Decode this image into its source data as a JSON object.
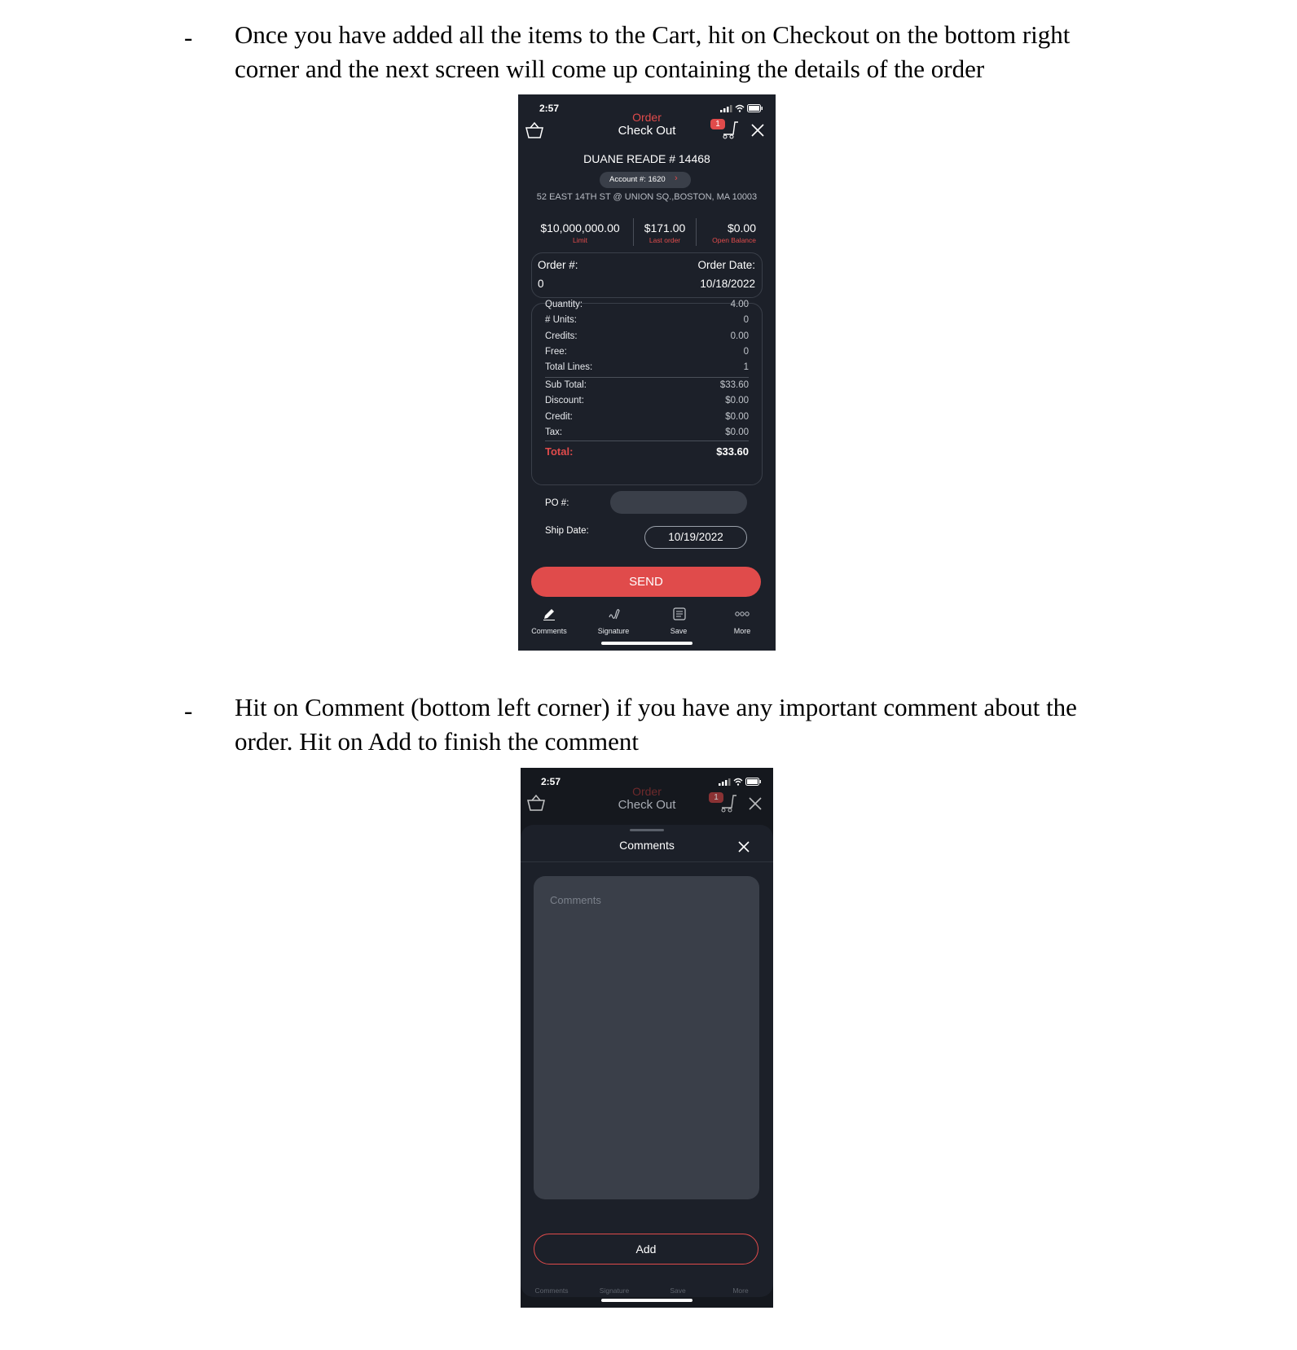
{
  "instructions": {
    "bullet": "-",
    "step1": "Once you have added all the items to the Cart, hit on Checkout on the bottom right corner and the next screen will come up containing the details of the order",
    "step2": "Hit on Comment (bottom left corner) if you have any important comment about the order. Hit on Add to finish the comment"
  },
  "screen1": {
    "time": "2:57",
    "title_top": "Order",
    "title_bottom": "Check Out",
    "cart_badge": "1",
    "store_name": "DUANE READE # 14468",
    "account": "Account #: 1620",
    "address": "52 EAST 14TH ST @ UNION SQ.,BOSTON, MA 10003",
    "stats": [
      {
        "value": "$10,000,000.00",
        "label": "Limit"
      },
      {
        "value": "$171.00",
        "label": "Last order"
      },
      {
        "value": "$0.00",
        "label": "Open Balance"
      }
    ],
    "order_no_label": "Order #:",
    "order_no_value": "0",
    "order_date_label": "Order Date:",
    "order_date_value": "10/18/2022",
    "summary_top": [
      {
        "label": "Quantity:",
        "value": "4.00"
      },
      {
        "label": "# Units:",
        "value": "0"
      },
      {
        "label": "Credits:",
        "value": "0.00"
      },
      {
        "label": "Free:",
        "value": "0"
      },
      {
        "label": "Total Lines:",
        "value": "1"
      }
    ],
    "summary_money": [
      {
        "label": "Sub Total:",
        "value": "$33.60"
      },
      {
        "label": "Discount:",
        "value": "$0.00"
      },
      {
        "label": "Credit:",
        "value": "$0.00"
      },
      {
        "label": "Tax:",
        "value": "$0.00"
      }
    ],
    "total_label": "Total:",
    "total_value": "$33.60",
    "po_label": "PO #:",
    "po_value": "",
    "ship_label": "Ship Date:",
    "ship_value": "10/19/2022",
    "send_label": "SEND",
    "tabs": [
      "Comments",
      "Signature",
      "Save",
      "More"
    ],
    "colors": {
      "background": "#1c2029",
      "accent": "#e04b4b"
    }
  },
  "screen2": {
    "time": "2:57",
    "title_top": "Order",
    "title_bottom": "Check Out",
    "cart_badge": "1",
    "sheet_title": "Comments",
    "comments_placeholder": "Comments",
    "add_label": "Add",
    "tabs": [
      "Comments",
      "Signature",
      "Save",
      "More"
    ]
  }
}
